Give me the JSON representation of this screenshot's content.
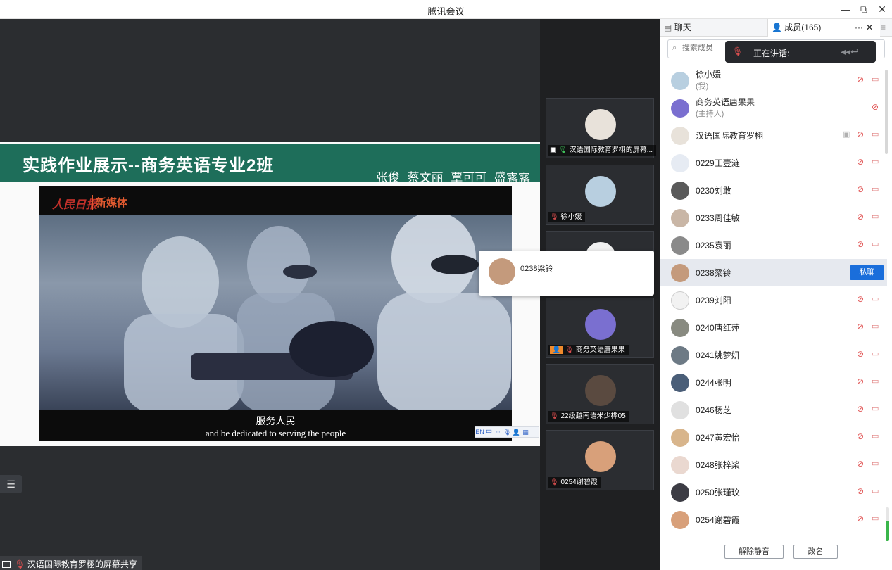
{
  "window": {
    "title": "腾讯会议",
    "controls": {
      "minimize": "—",
      "restore": "⧉",
      "close": "✕"
    }
  },
  "slide": {
    "title": "实践作业展示--商务英语专业2班",
    "names": "张俊 蔡文丽 覃可可 盛露露"
  },
  "video": {
    "logo": "人民日报",
    "logo_sub": "新媒体",
    "subtitle_cn": "服务人民",
    "subtitle_en": "and be dedicated to serving the people"
  },
  "toolstrip": [
    "EN",
    "中",
    "⁘",
    "🎙",
    "👤",
    "▦"
  ],
  "share_bar": {
    "label": "汉语国际教育罗栩的屏幕共享"
  },
  "gallery": [
    {
      "name": "汉语国际教育罗栩的屏幕..."
    },
    {
      "name": "徐小媛"
    },
    {
      "name": ""
    },
    {
      "name": "商务英语唐果果"
    },
    {
      "name": "22级越南语米少桦05"
    },
    {
      "name": "0254谢碧霞"
    }
  ],
  "hover_popup": {
    "name": "0238梁铃"
  },
  "panel": {
    "tab_chat": "聊天",
    "tab_members": "成员(165)",
    "more": "···",
    "close": "✕",
    "menu": "≡",
    "search_placeholder": "搜索成员",
    "speaking_label": "正在讲话:",
    "members": [
      {
        "name": "徐小媛",
        "sub": "(我)",
        "color": "#b8cfe0"
      },
      {
        "name": "商务英语唐果果",
        "sub": "(主持人)",
        "color": "#7a6fd0"
      },
      {
        "name": "汉语国际教育罗栩",
        "sub": "",
        "color": "#e8e2da"
      },
      {
        "name": "0229王壹涟",
        "sub": "",
        "color": "#e6ebf3"
      },
      {
        "name": "0230刘敢",
        "sub": "",
        "color": "#5a5a5a"
      },
      {
        "name": "0233周佳敏",
        "sub": "",
        "color": "#c9b6a6"
      },
      {
        "name": "0235袁丽",
        "sub": "",
        "color": "#8a8a8a"
      },
      {
        "name": "0238梁铃",
        "sub": "",
        "color": "#c49a7c"
      },
      {
        "name": "0239刘阳",
        "sub": "",
        "color": "#f2f2f2"
      },
      {
        "name": "0240唐红萍",
        "sub": "",
        "color": "#888a80"
      },
      {
        "name": "0241姚梦妍",
        "sub": "",
        "color": "#6d7a85"
      },
      {
        "name": "0244张明",
        "sub": "",
        "color": "#4a5e78"
      },
      {
        "name": "0246杨芝",
        "sub": "",
        "color": "#e0e0e0"
      },
      {
        "name": "0247黄宏怡",
        "sub": "",
        "color": "#d8b58c"
      },
      {
        "name": "0248张梓桨",
        "sub": "",
        "color": "#ead8d0"
      },
      {
        "name": "0250张瑾玟",
        "sub": "",
        "color": "#3c3c44"
      },
      {
        "name": "0254谢碧霞",
        "sub": "",
        "color": "#d8a07a"
      }
    ],
    "private_chat": "私聊",
    "unmute_all": "解除静音",
    "rename": "改名"
  }
}
